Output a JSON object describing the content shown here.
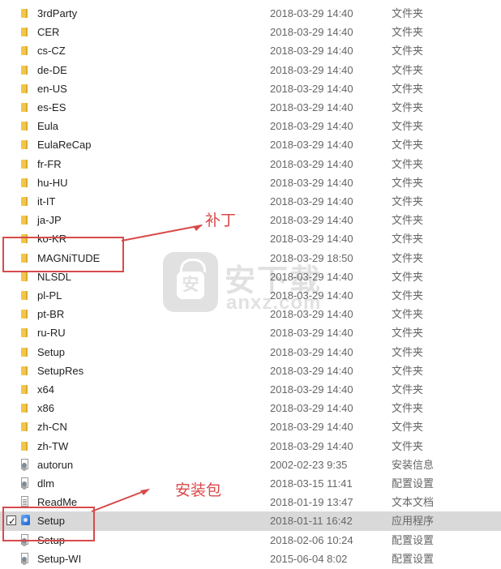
{
  "files": [
    {
      "name": "3rdParty",
      "date": "2018-03-29 14:40",
      "type": "文件夹",
      "icon": "folder-icon"
    },
    {
      "name": "CER",
      "date": "2018-03-29 14:40",
      "type": "文件夹",
      "icon": "folder-icon"
    },
    {
      "name": "cs-CZ",
      "date": "2018-03-29 14:40",
      "type": "文件夹",
      "icon": "folder-icon"
    },
    {
      "name": "de-DE",
      "date": "2018-03-29 14:40",
      "type": "文件夹",
      "icon": "folder-icon"
    },
    {
      "name": "en-US",
      "date": "2018-03-29 14:40",
      "type": "文件夹",
      "icon": "folder-icon"
    },
    {
      "name": "es-ES",
      "date": "2018-03-29 14:40",
      "type": "文件夹",
      "icon": "folder-icon"
    },
    {
      "name": "Eula",
      "date": "2018-03-29 14:40",
      "type": "文件夹",
      "icon": "folder-icon"
    },
    {
      "name": "EulaReCap",
      "date": "2018-03-29 14:40",
      "type": "文件夹",
      "icon": "folder-icon"
    },
    {
      "name": "fr-FR",
      "date": "2018-03-29 14:40",
      "type": "文件夹",
      "icon": "folder-icon"
    },
    {
      "name": "hu-HU",
      "date": "2018-03-29 14:40",
      "type": "文件夹",
      "icon": "folder-icon"
    },
    {
      "name": "it-IT",
      "date": "2018-03-29 14:40",
      "type": "文件夹",
      "icon": "folder-icon"
    },
    {
      "name": "ja-JP",
      "date": "2018-03-29 14:40",
      "type": "文件夹",
      "icon": "folder-icon"
    },
    {
      "name": "ko-KR",
      "date": "2018-03-29 14:40",
      "type": "文件夹",
      "icon": "folder-icon"
    },
    {
      "name": "MAGNiTUDE",
      "date": "2018-03-29 18:50",
      "type": "文件夹",
      "icon": "folder-icon"
    },
    {
      "name": "NLSDL",
      "date": "2018-03-29 14:40",
      "type": "文件夹",
      "icon": "folder-icon"
    },
    {
      "name": "pl-PL",
      "date": "2018-03-29 14:40",
      "type": "文件夹",
      "icon": "folder-icon"
    },
    {
      "name": "pt-BR",
      "date": "2018-03-29 14:40",
      "type": "文件夹",
      "icon": "folder-icon"
    },
    {
      "name": "ru-RU",
      "date": "2018-03-29 14:40",
      "type": "文件夹",
      "icon": "folder-icon"
    },
    {
      "name": "Setup",
      "date": "2018-03-29 14:40",
      "type": "文件夹",
      "icon": "folder-icon"
    },
    {
      "name": "SetupRes",
      "date": "2018-03-29 14:40",
      "type": "文件夹",
      "icon": "folder-icon"
    },
    {
      "name": "x64",
      "date": "2018-03-29 14:40",
      "type": "文件夹",
      "icon": "folder-icon"
    },
    {
      "name": "x86",
      "date": "2018-03-29 14:40",
      "type": "文件夹",
      "icon": "folder-icon"
    },
    {
      "name": "zh-CN",
      "date": "2018-03-29 14:40",
      "type": "文件夹",
      "icon": "folder-icon"
    },
    {
      "name": "zh-TW",
      "date": "2018-03-29 14:40",
      "type": "文件夹",
      "icon": "folder-icon"
    },
    {
      "name": "autorun",
      "date": "2002-02-23 9:35",
      "type": "安装信息",
      "icon": "settings-file-icon"
    },
    {
      "name": "dlm",
      "date": "2018-03-15 11:41",
      "type": "配置设置",
      "icon": "settings-file-icon"
    },
    {
      "name": "ReadMe",
      "date": "2018-01-19 13:47",
      "type": "文本文档",
      "icon": "text-file-icon"
    },
    {
      "name": "Setup",
      "date": "2018-01-11 16:42",
      "type": "应用程序",
      "icon": "application-icon",
      "selected": true,
      "checked": true
    },
    {
      "name": "Setup",
      "date": "2018-02-06 10:24",
      "type": "配置设置",
      "icon": "settings-file-icon"
    },
    {
      "name": "Setup-WI",
      "date": "2015-06-04 8:02",
      "type": "配置设置",
      "icon": "settings-file-icon"
    }
  ],
  "annotations": {
    "patch_label": "补丁",
    "installer_label": "安装包"
  },
  "watermark": {
    "logo_text": "安",
    "chinese_text": "安下载",
    "domain_text": "anxz.com"
  },
  "colors": {
    "annotation": "#d84a4a",
    "folder": "#f2c64b",
    "selected_row": "#d9d9d9",
    "secondary_text": "#666666"
  }
}
